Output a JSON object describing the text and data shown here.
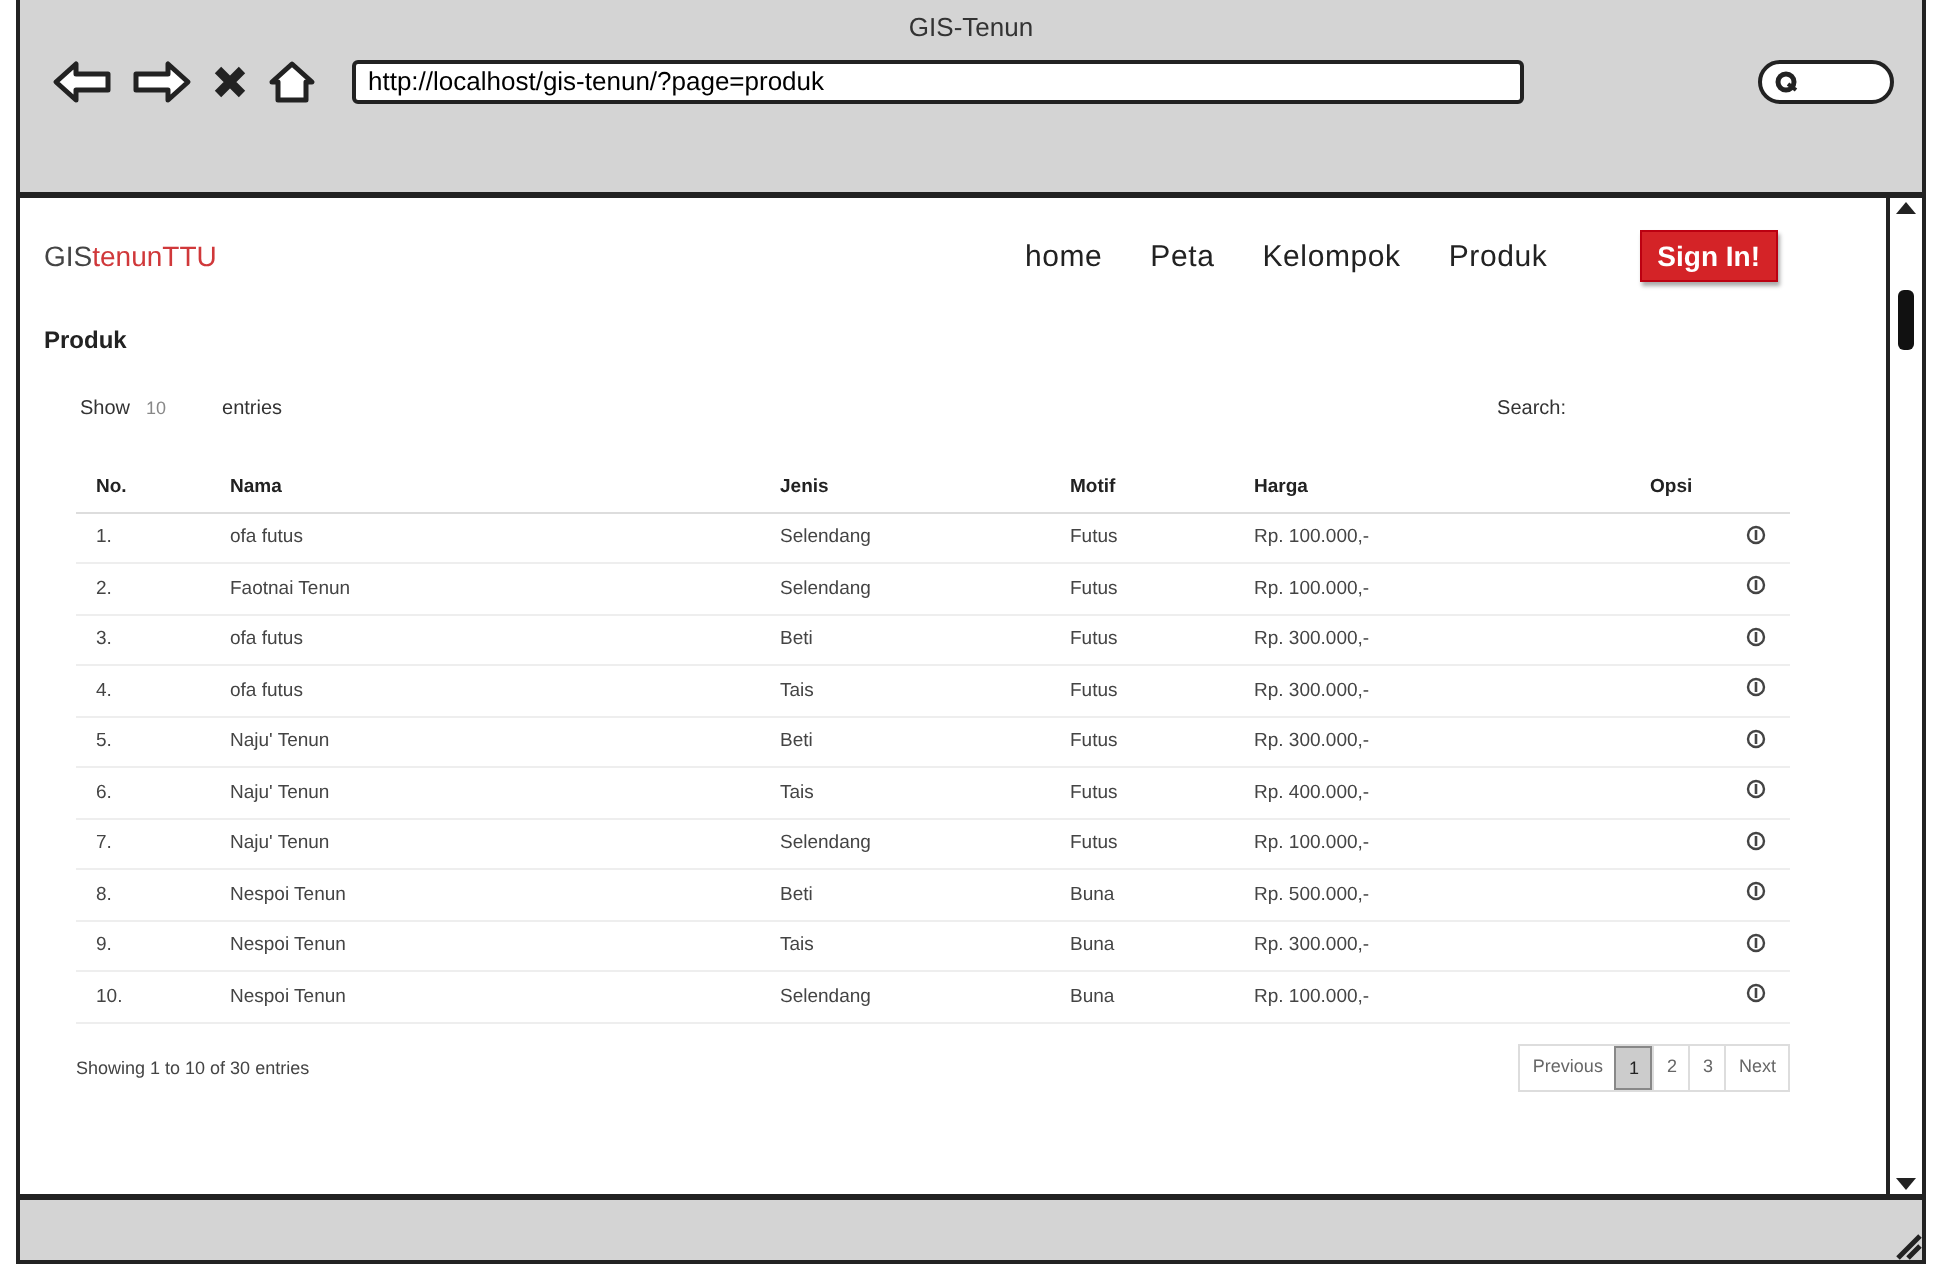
{
  "window": {
    "title": "GIS-Tenun",
    "url": "http://localhost/gis-tenun/?page=produk"
  },
  "site": {
    "logo_prefix": "GIS",
    "logo_suffix": "tenunTTU",
    "nav": [
      {
        "label": "home"
      },
      {
        "label": "Peta"
      },
      {
        "label": "Kelompok"
      },
      {
        "label": "Produk"
      }
    ],
    "signin": "Sign In!"
  },
  "page_title": "Produk",
  "length": {
    "before": "Show",
    "value": "10",
    "after": "entries"
  },
  "search": {
    "label": "Search:"
  },
  "table": {
    "columns": [
      "No.",
      "Nama",
      "Jenis",
      "Motif",
      "Harga",
      "Opsi"
    ],
    "rows": [
      {
        "no": "1.",
        "nama": "ofa futus",
        "jenis": "Selendang",
        "motif": "Futus",
        "harga": "Rp. 100.000,-"
      },
      {
        "no": "2.",
        "nama": "Faotnai Tenun",
        "jenis": "Selendang",
        "motif": "Futus",
        "harga": "Rp. 100.000,-"
      },
      {
        "no": "3.",
        "nama": "ofa futus",
        "jenis": "Beti",
        "motif": "Futus",
        "harga": "Rp. 300.000,-"
      },
      {
        "no": "4.",
        "nama": "ofa futus",
        "jenis": "Tais",
        "motif": "Futus",
        "harga": "Rp. 300.000,-"
      },
      {
        "no": "5.",
        "nama": "Naju' Tenun",
        "jenis": "Beti",
        "motif": "Futus",
        "harga": "Rp. 300.000,-"
      },
      {
        "no": "6.",
        "nama": "Naju' Tenun",
        "jenis": "Tais",
        "motif": "Futus",
        "harga": "Rp. 400.000,-"
      },
      {
        "no": "7.",
        "nama": "Naju' Tenun",
        "jenis": "Selendang",
        "motif": "Futus",
        "harga": "Rp. 100.000,-"
      },
      {
        "no": "8.",
        "nama": "Nespoi Tenun",
        "jenis": "Beti",
        "motif": "Buna",
        "harga": "Rp. 500.000,-"
      },
      {
        "no": "9.",
        "nama": "Nespoi Tenun",
        "jenis": "Tais",
        "motif": "Buna",
        "harga": "Rp. 300.000,-"
      },
      {
        "no": "10.",
        "nama": "Nespoi Tenun",
        "jenis": "Selendang",
        "motif": "Buna",
        "harga": "Rp. 100.000,-"
      }
    ]
  },
  "info": "Showing 1 to 10 of 30 entries",
  "pagination": [
    {
      "label": "Previous",
      "selected": false
    },
    {
      "label": "1",
      "selected": true
    },
    {
      "label": "2",
      "selected": false
    },
    {
      "label": "3",
      "selected": false
    },
    {
      "label": "Next",
      "selected": false
    }
  ]
}
